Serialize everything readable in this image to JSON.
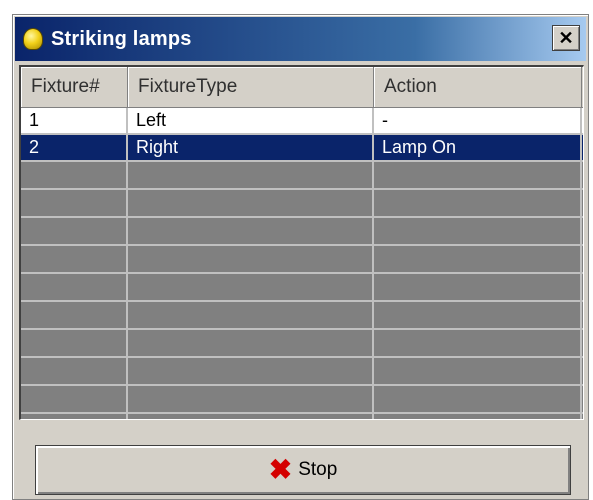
{
  "window": {
    "title": "Striking lamps",
    "close_glyph": "✕",
    "icon": "lamp-icon"
  },
  "table": {
    "columns": [
      "Fixture#",
      "FixtureType",
      "Action"
    ],
    "rows": [
      {
        "fixture": "1",
        "type": "Left",
        "action": "-"
      },
      {
        "fixture": "2",
        "type": "Right",
        "action": "Lamp On"
      }
    ],
    "selected_row": 1
  },
  "footer": {
    "stop_label": "Stop",
    "stop_icon": "red-x-icon",
    "stop_glyph": "✖"
  },
  "colors": {
    "title_bar": "#0a246a",
    "selection": "#0a246a",
    "stop_icon": "#d40000"
  }
}
